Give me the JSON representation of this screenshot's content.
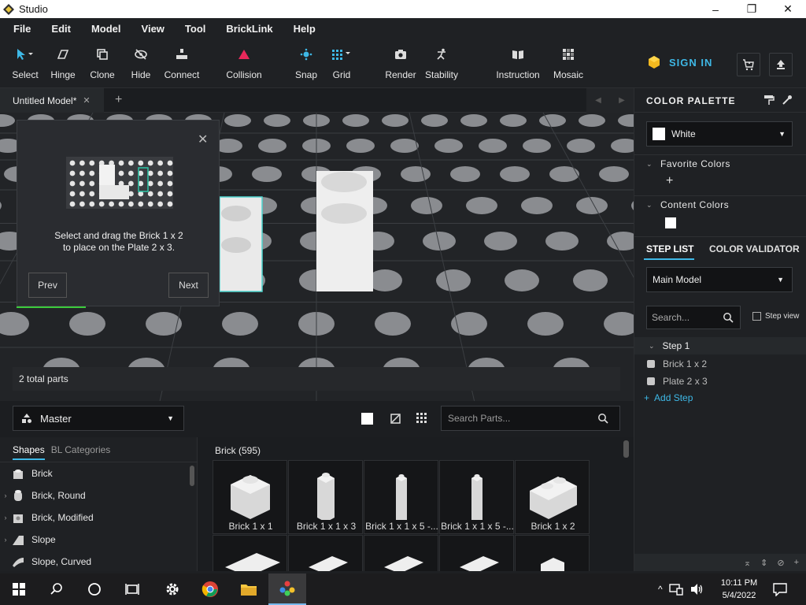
{
  "window": {
    "title": "Studio",
    "minimize": "–",
    "maximize": "❐",
    "close": "✕"
  },
  "menu": [
    "File",
    "Edit",
    "Model",
    "View",
    "Tool",
    "BrickLink",
    "Help"
  ],
  "toolbar": {
    "select": "Select",
    "hinge": "Hinge",
    "clone": "Clone",
    "hide": "Hide",
    "connect": "Connect",
    "collision": "Collision",
    "snap": "Snap",
    "grid": "Grid",
    "render": "Render",
    "stability": "Stability",
    "instruction": "Instruction",
    "mosaic": "Mosaic",
    "sign_in": "SIGN IN"
  },
  "tabs": {
    "model": "Untitled Model*",
    "close": "✕",
    "add": "+"
  },
  "viewport": {
    "parts_count": "2 total parts"
  },
  "tutorial": {
    "line1": "Select and drag the Brick 1 x 2",
    "line2": "to place on the Plate 2 x 3.",
    "prev": "Prev",
    "next": "Next",
    "close": "✕"
  },
  "parts": {
    "palette": "Master",
    "search_placeholder": "Search Parts...",
    "tabs": {
      "shapes": "Shapes",
      "bl_categories": "BL Categories"
    },
    "categories": [
      {
        "label": "Brick",
        "arrow": ""
      },
      {
        "label": "Brick, Round",
        "arrow": "›"
      },
      {
        "label": "Brick, Modified",
        "arrow": "›"
      },
      {
        "label": "Slope",
        "arrow": "›"
      },
      {
        "label": "Slope, Curved",
        "arrow": ""
      }
    ],
    "grid_title": "Brick (595)",
    "items": [
      "Brick 1 x 1",
      "Brick 1 x 1 x 3",
      "Brick 1 x 1 x 5 -...",
      "Brick 1 x 1 x 5 -...",
      "Brick 1 x 2"
    ]
  },
  "right": {
    "color_palette": "COLOR PALETTE",
    "selected_color": "White",
    "favorite_colors": "Favorite Colors",
    "content_colors": "Content Colors",
    "add": "+",
    "step_list": "STEP LIST",
    "color_validator": "COLOR VALIDATOR",
    "model": "Main Model",
    "search_placeholder": "Search...",
    "step_view": "Step view",
    "step": "Step 1",
    "step_parts": [
      "Brick 1 x 2",
      "Plate 2 x 3"
    ],
    "add_step": "Add Step"
  },
  "taskbar": {
    "time": "10:11 PM",
    "date": "5/4/2022"
  },
  "colors": {
    "accent": "#3eb8e6",
    "collision": "#e8285a",
    "white": "#ffffff"
  }
}
